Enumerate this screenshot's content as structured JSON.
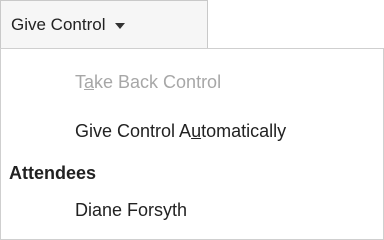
{
  "control_dropdown": {
    "label": "Give Control",
    "caret_icon": "caret-down-icon"
  },
  "menu": {
    "items": [
      {
        "label": "Take Back Control",
        "parts": [
          "T",
          "a",
          "ke Back Control"
        ],
        "enabled": false
      },
      {
        "label": "Give Control Automatically",
        "parts": [
          "Give Control A",
          "u",
          "tomatically"
        ],
        "enabled": true
      }
    ],
    "section_title": "Attendees",
    "attendees": [
      "Diane Forsyth"
    ]
  },
  "colors": {
    "text": "#222222",
    "disabled_text": "#a7a7a7",
    "button_bg": "#f6f6f6",
    "border": "#cfcfcf"
  }
}
